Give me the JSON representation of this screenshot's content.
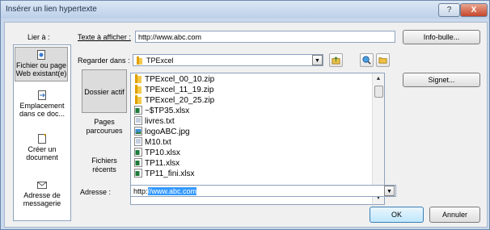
{
  "dialog": {
    "title": "Insérer un lien hypertexte",
    "help_label": "?",
    "close_label": "X"
  },
  "link_to": {
    "label": "Lier à :",
    "items": [
      {
        "label": "Fichier ou page Web existant(e)",
        "icon": "web-page-icon",
        "selected": true
      },
      {
        "label": "Emplacement dans ce doc...",
        "icon": "document-location-icon",
        "selected": false
      },
      {
        "label": "Créer un document",
        "icon": "new-document-icon",
        "selected": false
      },
      {
        "label": "Adresse de messagerie",
        "icon": "email-icon",
        "selected": false
      }
    ]
  },
  "text_to_display": {
    "label": "Texte à afficher :",
    "value": "http://www.abc.com"
  },
  "info_bubble_button": "Info-bulle...",
  "look_in": {
    "label": "Regarder dans :",
    "value": "TPExcel"
  },
  "signet_button": "Signet...",
  "nav": {
    "items": [
      "Dossier actif",
      "Pages parcourues",
      "Fichiers récents"
    ]
  },
  "files": [
    {
      "name": "TPExcel_00_10.zip",
      "icon": "zip-folder-icon"
    },
    {
      "name": "TPExcel_11_19.zip",
      "icon": "zip-folder-icon"
    },
    {
      "name": "TPExcel_20_25.zip",
      "icon": "zip-folder-icon"
    },
    {
      "name": "~$TP35.xlsx",
      "icon": "excel-file-icon"
    },
    {
      "name": "livres.txt",
      "icon": "text-file-icon"
    },
    {
      "name": "logoABC.jpg",
      "icon": "image-file-icon"
    },
    {
      "name": "M10.txt",
      "icon": "text-file-icon"
    },
    {
      "name": "TP10.xlsx",
      "icon": "excel-file-icon"
    },
    {
      "name": "TP11.xlsx",
      "icon": "excel-file-icon"
    },
    {
      "name": "TP11_fini.xlsx",
      "icon": "excel-file-icon"
    }
  ],
  "address": {
    "label": "Adresse :",
    "prefix": "http:",
    "selected": "//www.abc.com"
  },
  "buttons": {
    "ok": "OK",
    "cancel": "Annuler"
  },
  "colors": {
    "title_bg": "#bccfe8",
    "selection": "#3399ff",
    "close_button": "#c4462a"
  }
}
